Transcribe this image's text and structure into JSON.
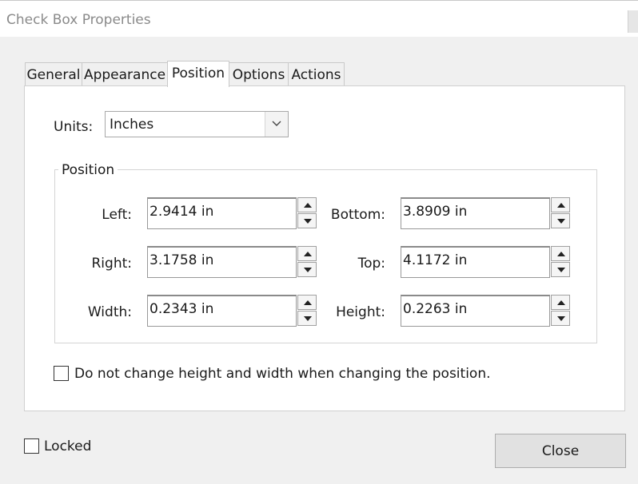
{
  "window": {
    "title": "Check Box Properties"
  },
  "tabs": [
    {
      "label": "General",
      "active": false
    },
    {
      "label": "Appearance",
      "active": false
    },
    {
      "label": "Position",
      "active": true
    },
    {
      "label": "Options",
      "active": false
    },
    {
      "label": "Actions",
      "active": false
    }
  ],
  "units": {
    "label": "Units:",
    "value": "Inches"
  },
  "position_group": {
    "label": "Position",
    "left": {
      "label": "Left:",
      "value": "2.9414 in"
    },
    "bottom": {
      "label": "Bottom:",
      "value": "3.8909 in"
    },
    "right": {
      "label": "Right:",
      "value": "3.1758 in"
    },
    "top": {
      "label": "Top:",
      "value": "4.1172 in"
    },
    "width": {
      "label": "Width:",
      "value": "0.2343 in"
    },
    "height": {
      "label": "Height:",
      "value": "0.2263 in"
    }
  },
  "keep_size_checkbox": {
    "label": "Do not change height and width when changing the position.",
    "checked": false
  },
  "locked_checkbox": {
    "label": "Locked",
    "checked": false
  },
  "close_button": {
    "label": "Close"
  },
  "colors": {
    "window_bg": "#f0f0f0",
    "panel_bg": "#ffffff",
    "title_text": "#8a8a8a",
    "button_bg": "#e1e1e1"
  },
  "icons": {
    "dropdown": "chevron-down-icon",
    "spin_up": "spin-up-icon",
    "spin_down": "spin-down-icon"
  }
}
